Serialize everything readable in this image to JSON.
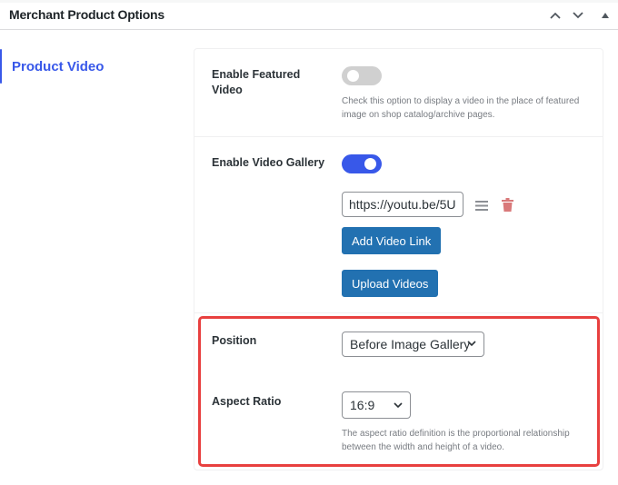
{
  "header": {
    "title": "Merchant Product Options",
    "controls": {
      "move_up": "chevron-up-icon",
      "move_down": "chevron-down-icon",
      "toggle_panel": "triangle-up-icon"
    }
  },
  "sidenav": {
    "items": [
      {
        "label": "Product Video",
        "active": true
      }
    ]
  },
  "settings": {
    "featured_video": {
      "label": "Enable Featured Video",
      "enabled": false,
      "description": "Check this option to display a video in the place of featured image on shop catalog/archive pages."
    },
    "video_gallery": {
      "label": "Enable Video Gallery",
      "enabled": true,
      "links": [
        {
          "value": "https://youtu.be/5U"
        }
      ],
      "drag_icon": "hamburger-icon",
      "delete_icon": "trash-icon",
      "add_link_label": "Add Video Link",
      "upload_label": "Upload Videos"
    },
    "position": {
      "label": "Position",
      "selected": "Before Image Gallery"
    },
    "aspect_ratio": {
      "label": "Aspect Ratio",
      "selected": "16:9",
      "description": "The aspect ratio definition is the proportional relationship between the width and height of a video."
    }
  },
  "colors": {
    "accent": "#3858e9",
    "button": "#2271b1",
    "delete": "#d63638",
    "highlight": "#e8403f",
    "toggle_off": "#d0d0d0"
  }
}
